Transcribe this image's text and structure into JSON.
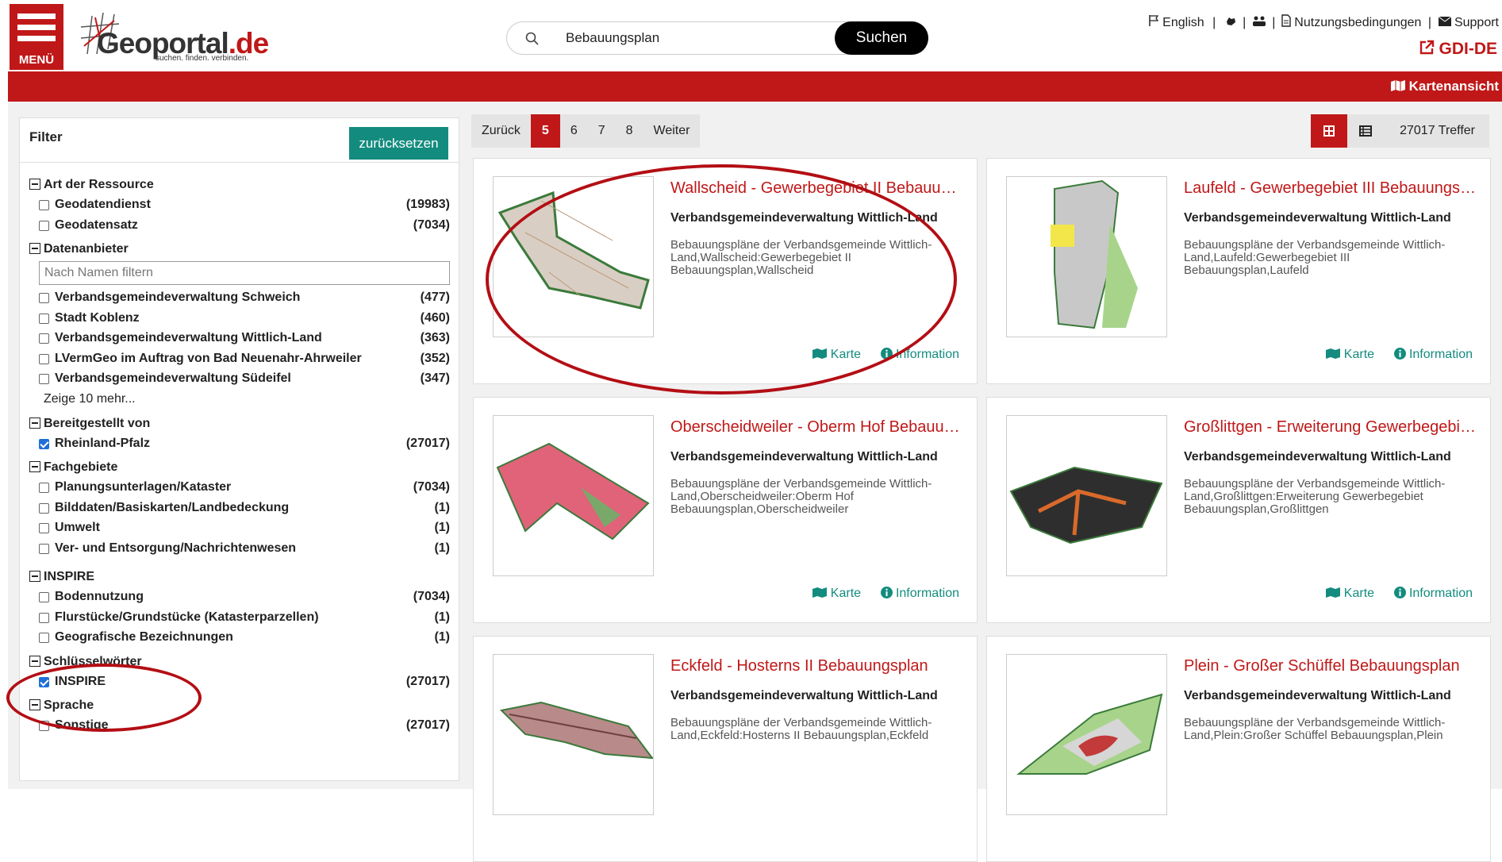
{
  "header": {
    "menu_label": "MENÜ",
    "logo_text": "Geoportal",
    "logo_tld": ".de",
    "logo_tagline": "suchen. finden. verbinden.",
    "search_value": "Bebauungsplan",
    "search_button": "Suchen",
    "lang_link": "English",
    "sep1": "|",
    "nutzungs": "Nutzungsbedingungen",
    "sep2": "|",
    "support": "Support",
    "gdi": "GDI-DE"
  },
  "redbar": {
    "kartenansicht": "Kartenansicht"
  },
  "filter": {
    "title": "Filter",
    "reset": "zurücksetzen",
    "groups": [
      {
        "name": "Art der Ressource",
        "items": [
          {
            "label": "Geodatendienst",
            "count": "(19983)",
            "checked": false
          },
          {
            "label": "Geodatensatz",
            "count": "(7034)",
            "checked": false
          }
        ]
      },
      {
        "name": "Datenanbieter",
        "filter_placeholder": "Nach Namen filtern",
        "more": "Zeige 10 mehr...",
        "items": [
          {
            "label": "Verbandsgemeindeverwaltung Schweich",
            "count": "(477)",
            "checked": false
          },
          {
            "label": "Stadt Koblenz",
            "count": "(460)",
            "checked": false
          },
          {
            "label": "Verbandsgemeindeverwaltung Wittlich-Land",
            "count": "(363)",
            "checked": false
          },
          {
            "label": "LVermGeo im Auftrag von Bad Neuenahr-Ahrweiler",
            "count": "(352)",
            "checked": false
          },
          {
            "label": "Verbandsgemeindeverwaltung Südeifel",
            "count": "(347)",
            "checked": false
          }
        ]
      },
      {
        "name": "Bereitgestellt von",
        "items": [
          {
            "label": "Rheinland-Pfalz",
            "count": "(27017)",
            "checked": true
          }
        ]
      },
      {
        "name": "Fachgebiete",
        "items": [
          {
            "label": "Planungsunterlagen/Kataster",
            "count": "(7034)",
            "checked": false
          },
          {
            "label": "Bilddaten/Basiskarten/Landbedeckung",
            "count": "(1)",
            "checked": false
          },
          {
            "label": "Umwelt",
            "count": "(1)",
            "checked": false
          },
          {
            "label": "Ver- und Entsorgung/Nachrichtenwesen",
            "count": "(1)",
            "checked": false
          }
        ]
      },
      {
        "name": "INSPIRE",
        "items": [
          {
            "label": "Bodennutzung",
            "count": "(7034)",
            "checked": false
          },
          {
            "label": "Flurstücke/Grundstücke (Katasterparzellen)",
            "count": "(1)",
            "checked": false
          },
          {
            "label": "Geografische Bezeichnungen",
            "count": "(1)",
            "checked": false
          }
        ]
      },
      {
        "name": "Schlüsselwörter",
        "items": [
          {
            "label": "INSPIRE",
            "count": "(27017)",
            "checked": true
          }
        ]
      },
      {
        "name": "Sprache",
        "items": [
          {
            "label": "Sonstige",
            "count": "(27017)",
            "checked": false
          }
        ]
      }
    ]
  },
  "pager": {
    "prev": "Zurück",
    "pages": [
      "5",
      "6",
      "7",
      "8"
    ],
    "active": "5",
    "next": "Weiter"
  },
  "results": {
    "count": "27017 Treffer"
  },
  "cards": [
    {
      "title": "Wallscheid - Gewerbegebiet II Bebauungsplan",
      "org": "Verbandsgemeindeverwaltung Wittlich-Land",
      "desc": "Bebauungspläne der Verbandsgemeinde Wittlich-Land,Wallscheid:Gewerbegebiet II Bebauungsplan,Wallscheid",
      "karte": "Karte",
      "info": "Information"
    },
    {
      "title": "Laufeld - Gewerbegebiet III Bebauungsplan",
      "org": "Verbandsgemeindeverwaltung Wittlich-Land",
      "desc": "Bebauungspläne der Verbandsgemeinde Wittlich-Land,Laufeld:Gewerbegebiet III Bebauungsplan,Laufeld",
      "karte": "Karte",
      "info": "Information"
    },
    {
      "title": "Oberscheidweiler - Oberm Hof Bebauungsplan",
      "org": "Verbandsgemeindeverwaltung Wittlich-Land",
      "desc": "Bebauungspläne der Verbandsgemeinde Wittlich-Land,Oberscheidweiler:Oberm Hof Bebauungsplan,Oberscheidweiler",
      "karte": "Karte",
      "info": "Information"
    },
    {
      "title": "Großlittgen - Erweiterung Gewerbegebiet Bebauungsplan",
      "org": "Verbandsgemeindeverwaltung Wittlich-Land",
      "desc": "Bebauungspläne der Verbandsgemeinde Wittlich-Land,Großlittgen:Erweiterung Gewerbegebiet Bebauungsplan,Großlittgen",
      "karte": "Karte",
      "info": "Information"
    },
    {
      "title": "Eckfeld - Hosterns II Bebauungsplan",
      "org": "Verbandsgemeindeverwaltung Wittlich-Land",
      "desc": "Bebauungspläne der Verbandsgemeinde Wittlich-Land,Eckfeld:Hosterns II Bebauungsplan,Eckfeld",
      "karte": "Karte",
      "info": "Information"
    },
    {
      "title": "Plein - Großer Schüffel Bebauungsplan",
      "org": "Verbandsgemeindeverwaltung Wittlich-Land",
      "desc": "Bebauungspläne der Verbandsgemeinde Wittlich-Land,Plein:Großer Schüffel Bebauungsplan,Plein",
      "karte": "Karte",
      "info": "Information"
    }
  ]
}
